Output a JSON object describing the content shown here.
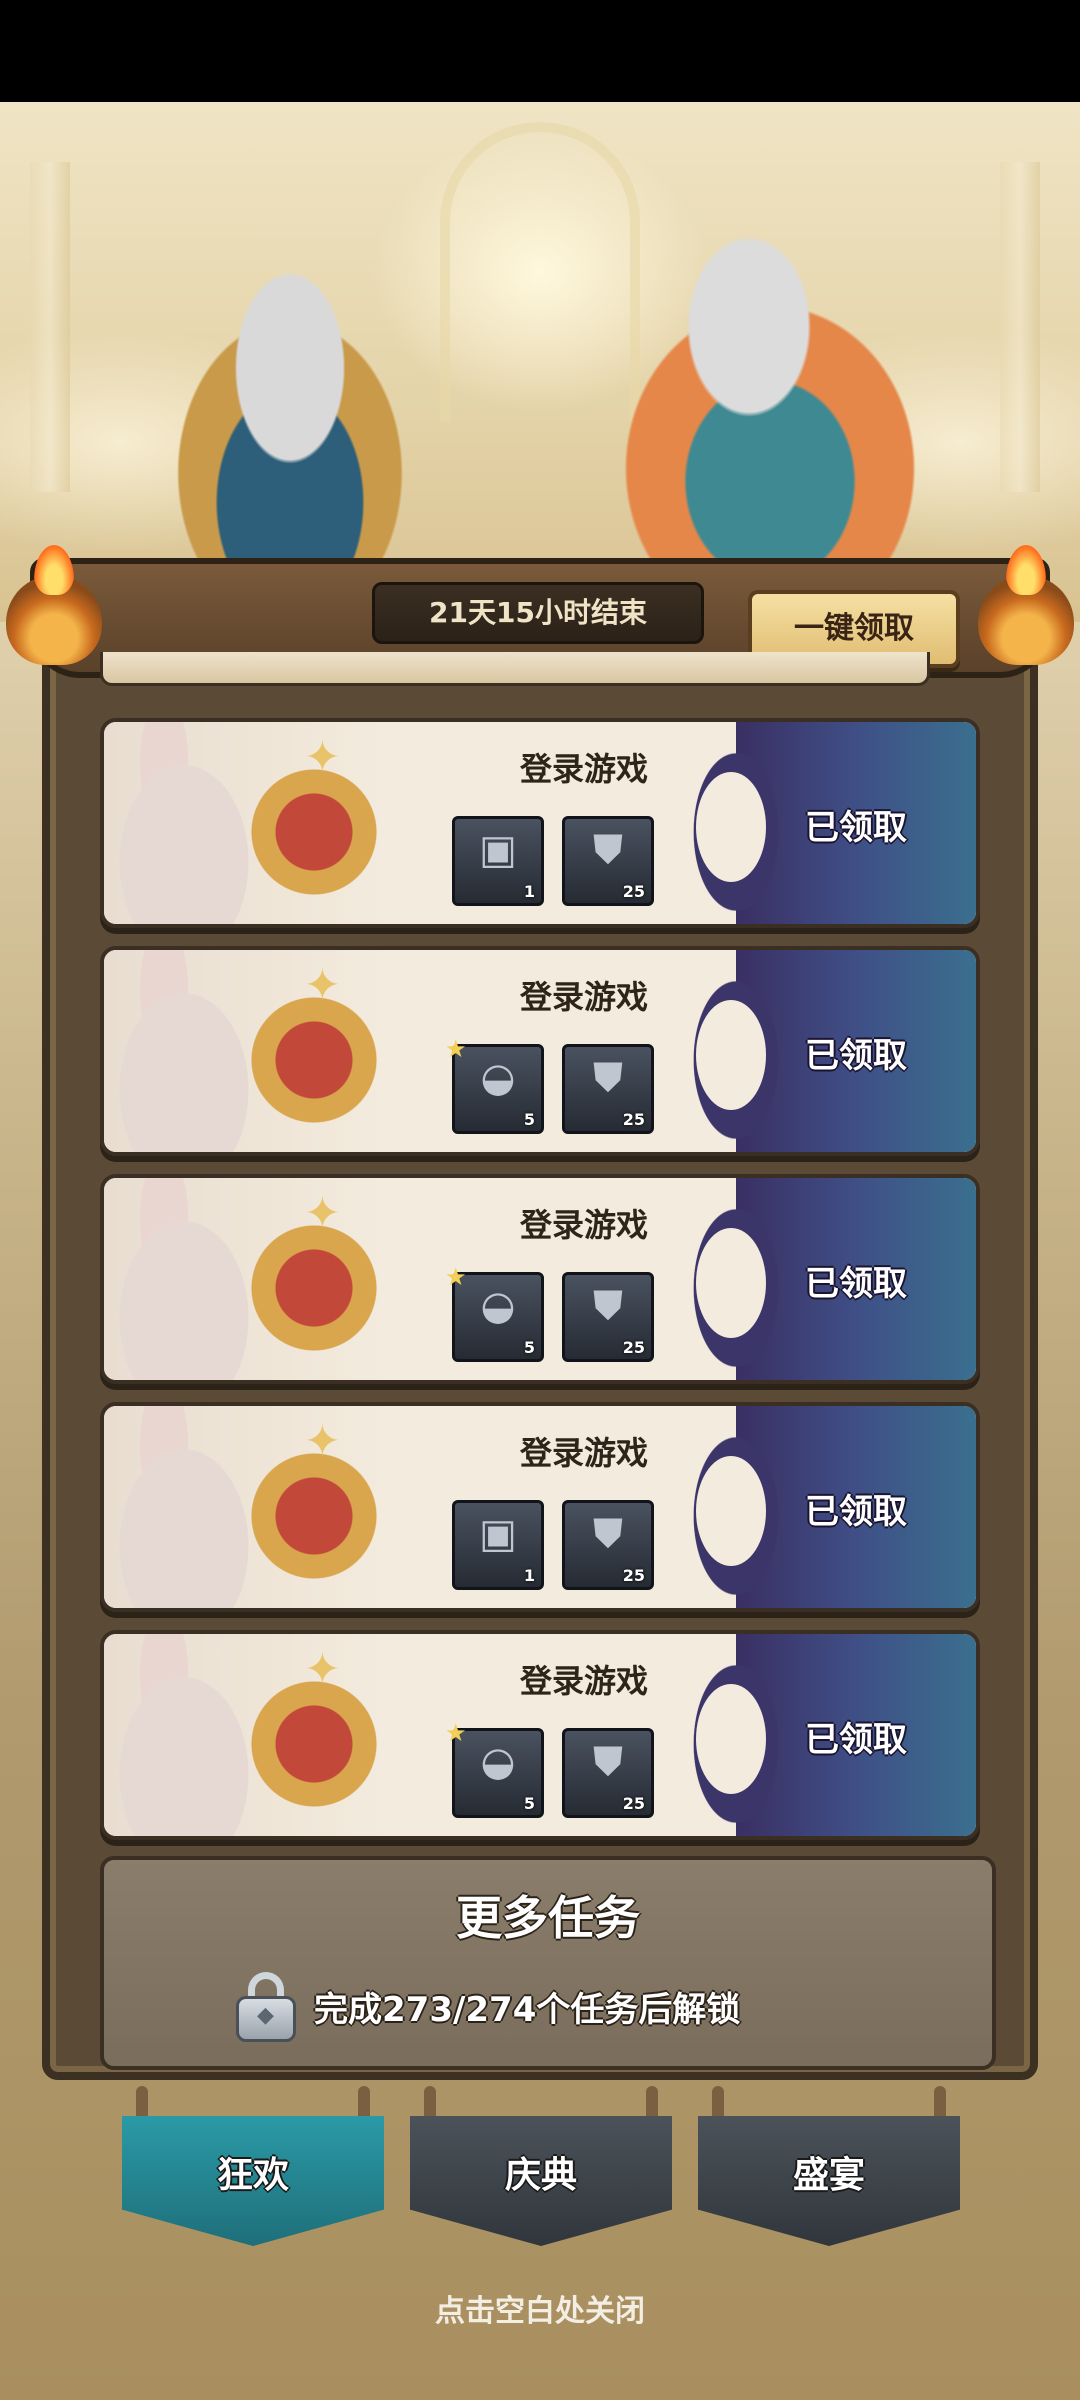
{
  "event": {
    "timer_text": "21天15小时结束",
    "claim_all_label": "一键领取"
  },
  "tasks": [
    {
      "title": "登录游戏",
      "status": "已领取",
      "rewards": [
        {
          "icon": "rune-stone-icon",
          "qty": "1",
          "star": false
        },
        {
          "icon": "armor-chest-icon",
          "qty": "25",
          "star": false
        }
      ]
    },
    {
      "title": "登录游戏",
      "status": "已领取",
      "rewards": [
        {
          "icon": "helmet-icon",
          "qty": "5",
          "star": true
        },
        {
          "icon": "armor-chest-icon",
          "qty": "25",
          "star": false
        }
      ]
    },
    {
      "title": "登录游戏",
      "status": "已领取",
      "rewards": [
        {
          "icon": "helmet-icon",
          "qty": "5",
          "star": true
        },
        {
          "icon": "armor-chest-icon",
          "qty": "25",
          "star": false
        }
      ]
    },
    {
      "title": "登录游戏",
      "status": "已领取",
      "rewards": [
        {
          "icon": "rune-stone-icon",
          "qty": "1",
          "star": false
        },
        {
          "icon": "armor-chest-icon",
          "qty": "25",
          "star": false
        }
      ]
    },
    {
      "title": "登录游戏",
      "status": "已领取",
      "rewards": [
        {
          "icon": "helmet-icon",
          "qty": "5",
          "star": true
        },
        {
          "icon": "armor-chest-icon",
          "qty": "25",
          "star": false
        }
      ]
    }
  ],
  "more_tasks": {
    "title": "更多任务",
    "lock_text": "完成273/274个任务后解锁"
  },
  "tabs": [
    {
      "label": "狂欢",
      "active": true
    },
    {
      "label": "庆典",
      "active": false
    },
    {
      "label": "盛宴",
      "active": false
    }
  ],
  "close_hint": "点击空白处关闭",
  "colors": {
    "claimed_bg": "#3f4f86",
    "tab_active": "#2a9aa6",
    "tab_inactive": "#4b5259",
    "claim_button": "#f5e0a3"
  }
}
